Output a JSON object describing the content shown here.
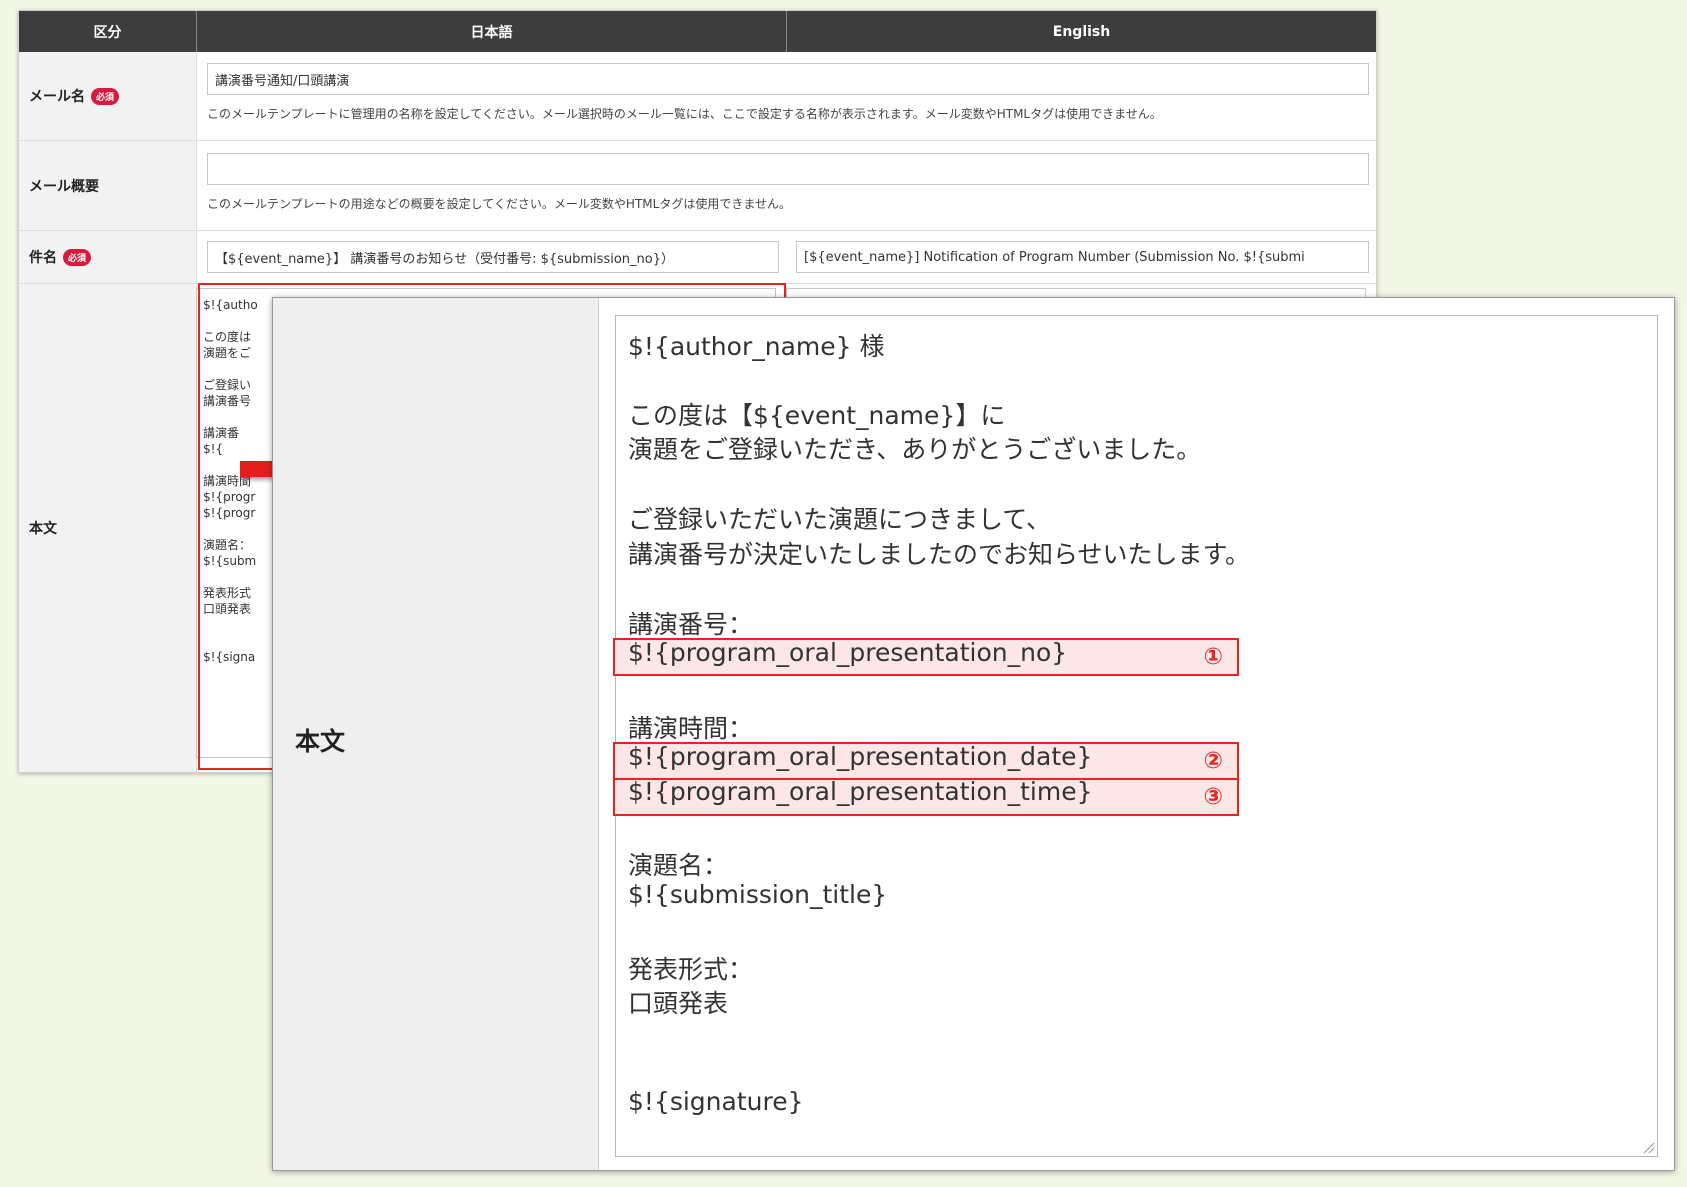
{
  "table": {
    "headers": {
      "category": "区分",
      "japanese": "日本語",
      "english": "English"
    },
    "required_badge": "必須",
    "rows": {
      "mail_name": {
        "label": "メール名",
        "value_ja": "講演番号通知/口頭講演",
        "help": "このメールテンプレートに管理用の名称を設定してください。メール選択時のメール一覧には、ここで設定する名称が表示されます。メール変数やHTMLタグは使用できません。"
      },
      "mail_summary": {
        "label": "メール概要",
        "value_ja": "",
        "help": "このメールテンプレートの用途などの概要を設定してください。メール変数やHTMLタグは使用できません。"
      },
      "subject": {
        "label": "件名",
        "value_ja": "【${event_name}】 講演番号のお知らせ（受付番号: ${submission_no}）",
        "value_en": "[${event_name}] Notification of Program Number (Submission No. $!{submi"
      },
      "body": {
        "label": "本文",
        "mini_preview": "$!{autho\n\nこの度は\n演題をご\n\nご登録い\n講演番号\n\n講演番\n$!{\n\n講演時間\n$!{progr\n$!{progr\n\n演題名：\n$!{subm\n\n発表形式\n口頭発表\n\n\n$!{signa"
      }
    }
  },
  "zoom": {
    "label": "本文",
    "lines": {
      "l1": "$!{author_name} 様",
      "l2": "この度は【${event_name}】に",
      "l3": "演題をご登録いただき、ありがとうございました。",
      "l4": "ご登録いただいた演題につきまして、",
      "l5": "講演番号が決定いたしましたのでお知らせいたします。",
      "l6": "講演番号：",
      "l7": "$!{program_oral_presentation_no}",
      "l8": "講演時間：",
      "l9": "$!{program_oral_presentation_date}",
      "l10": "$!{program_oral_presentation_time}",
      "l11": "演題名：",
      "l12": "$!{submission_title}",
      "l13": "発表形式：",
      "l14": "口頭発表",
      "l15": "$!{signature}"
    },
    "markers": {
      "m1": "①",
      "m2": "②",
      "m3": "③"
    }
  },
  "colors": {
    "highlight_red": "#e52424",
    "highlight_fill": "#fde6e6",
    "header_bg": "#3d3d3d",
    "badge_red": "#d7193d",
    "page_bg": "#f2f6e4"
  },
  "icons": {
    "arrow": "right-arrow-icon",
    "grip": "resize-grip-icon"
  }
}
